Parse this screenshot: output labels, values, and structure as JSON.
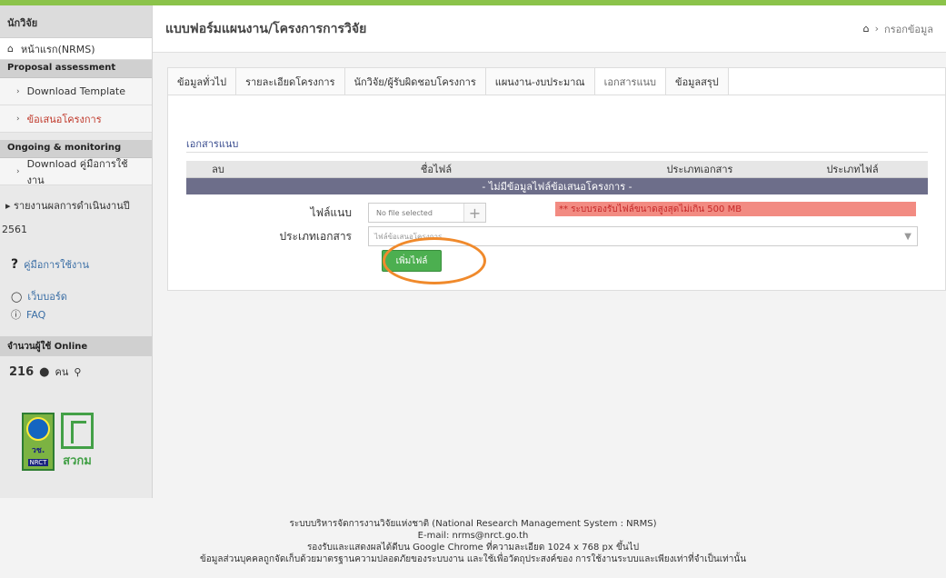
{
  "sidebar": {
    "user_label": "นักวิจัย",
    "home_label": "หน้าแรก(NRMS)",
    "section_proposal": "Proposal assessment",
    "proposal_items": [
      {
        "label": "Download Template"
      },
      {
        "label": "ข้อเสนอโครงการ"
      }
    ],
    "section_ongoing": "Ongoing & monitoring",
    "ongoing_items": [
      {
        "label": "Download คู่มือการใช้งาน"
      }
    ],
    "report_line1": "รายงานผลการดำเนินงานปี",
    "report_line2": "2561",
    "help_label": "คู่มือการใช้งาน",
    "webboard_label": "เว็บบอร์ด",
    "faq_label": "FAQ",
    "online_header": "จำนวนผู้ใช้ Online",
    "online_count": "216",
    "online_unit": "คน",
    "logo_text_1": "วช.",
    "logo_text_2": "NRCT",
    "logo_text_3": "สวกม"
  },
  "header": {
    "title": "แบบฟอร์มแผนงาน/โครงการการวิจัย",
    "breadcrumb": "กรอกข้อมูล"
  },
  "tabs": [
    {
      "label": "ข้อมูลทั่วไป",
      "active": false
    },
    {
      "label": "รายละเอียดโครงการ",
      "active": false
    },
    {
      "label": "นักวิจัย/ผู้รับผิดชอบโครงการ",
      "active": false
    },
    {
      "label": "แผนงาน-งบประมาณ",
      "active": false
    },
    {
      "label": "เอกสารแนบ",
      "active": true
    },
    {
      "label": "ข้อมูลสรุป",
      "active": false
    }
  ],
  "attachments": {
    "section_title": "เอกสารแนบ",
    "columns": [
      "ลบ",
      "ชื่อไฟล์",
      "ประเภทเอกสาร",
      "ประเภทไฟล์"
    ],
    "empty_message": "- ไม่มีข้อมูลไฟล์ข้อเสนอโครงการ -",
    "file_label": "ไฟล์แนบ",
    "file_placeholder": "No file selected",
    "size_warning": "** ระบบรองรับไฟล์ขนาดสูงสุดไม่เกิน 500 MB",
    "doctype_label": "ประเภทเอกสาร",
    "doctype_value": "ไฟล์ข้อเสนอโครงการ",
    "add_button": "เพิ่มไฟล์"
  },
  "footer": {
    "line1": "ระบบบริหารจัดการงานวิจัยแห่งชาติ (National Research Management System : NRMS)",
    "line2": "E-mail: nrms@nrct.go.th",
    "line3": "รองรับและแสดงผลได้ดีบน Google Chrome ที่ความละเอียด 1024 x 768 px ขึ้นไป",
    "line4": "ข้อมูลส่วนบุคคลถูกจัดเก็บด้วยมาตรฐานความปลอดภัยของระบบงาน และใช้เพื่อวัตถุประสงค์ของ การใช้งานระบบและเพียงเท่าที่จำเป็นเท่านั้น"
  },
  "colors": {
    "topbar": "#8bc34a",
    "active_item": "#c0392b",
    "empty_row": "#6d6e8a",
    "warning_bg": "#f28b82",
    "add_button": "#4caf50",
    "highlight_circle": "#f08a2c"
  }
}
